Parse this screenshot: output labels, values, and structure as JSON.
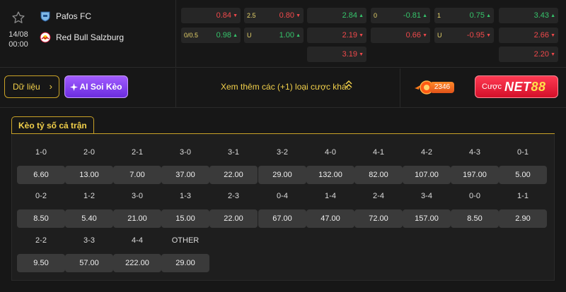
{
  "match": {
    "date": "14/08",
    "time": "00:00",
    "home_team": "Pafos FC",
    "away_team": "Red Bull Salzburg"
  },
  "odds": {
    "row1": [
      {
        "line": "",
        "value": "0.84",
        "dir": "down"
      },
      {
        "line": "2.5",
        "value": "0.80",
        "dir": "down"
      },
      {
        "line": "",
        "value": "2.84",
        "dir": "up"
      },
      {
        "line": "0",
        "value": "-0.81",
        "dir": "up"
      },
      {
        "line": "1",
        "value": "0.75",
        "dir": "up"
      },
      {
        "line": "",
        "value": "3.43",
        "dir": "up"
      }
    ],
    "row2": [
      {
        "line": "0/0.5",
        "value": "0.98",
        "dir": "up"
      },
      {
        "line": "U",
        "value": "1.00",
        "dir": "up"
      },
      {
        "line": "",
        "value": "2.19",
        "dir": "down"
      },
      {
        "line": "",
        "value": "0.66",
        "dir": "down"
      },
      {
        "line": "U",
        "value": "-0.95",
        "dir": "down"
      },
      {
        "line": "",
        "value": "2.66",
        "dir": "down"
      }
    ],
    "row3": [
      {
        "line": "",
        "value": "3.19",
        "dir": "down"
      },
      {
        "line": "",
        "value": "2.20",
        "dir": "down"
      }
    ]
  },
  "actions": {
    "data_label": "Dữ liệu",
    "ai_label": "AI Soi Kèo",
    "more_label": "Xem thêm các (+1) loại cược khác",
    "promo_count": "2346",
    "cuoc_label": "Cược",
    "net_label": "NET",
    "net_num": "88"
  },
  "score_tab": "Kèo tỷ số cả trận",
  "scores": [
    {
      "score": "1-0",
      "odd": "6.60"
    },
    {
      "score": "2-0",
      "odd": "13.00"
    },
    {
      "score": "2-1",
      "odd": "7.00"
    },
    {
      "score": "3-0",
      "odd": "37.00"
    },
    {
      "score": "3-1",
      "odd": "22.00"
    },
    {
      "score": "3-2",
      "odd": "29.00"
    },
    {
      "score": "4-0",
      "odd": "132.00"
    },
    {
      "score": "4-1",
      "odd": "82.00"
    },
    {
      "score": "4-2",
      "odd": "107.00"
    },
    {
      "score": "4-3",
      "odd": "197.00"
    },
    {
      "score": "0-1",
      "odd": "5.00"
    },
    {
      "score": "0-2",
      "odd": "8.50"
    },
    {
      "score": "1-2",
      "odd": "5.40"
    },
    {
      "score": "3-0",
      "odd": "21.00"
    },
    {
      "score": "1-3",
      "odd": "15.00"
    },
    {
      "score": "2-3",
      "odd": "22.00"
    },
    {
      "score": "0-4",
      "odd": "67.00"
    },
    {
      "score": "1-4",
      "odd": "47.00"
    },
    {
      "score": "2-4",
      "odd": "72.00"
    },
    {
      "score": "3-4",
      "odd": "157.00"
    },
    {
      "score": "0-0",
      "odd": "8.50"
    },
    {
      "score": "1-1",
      "odd": "2.90"
    },
    {
      "score": "2-2",
      "odd": "9.50"
    },
    {
      "score": "3-3",
      "odd": "57.00"
    },
    {
      "score": "4-4",
      "odd": "222.00"
    },
    {
      "score": "OTHER",
      "odd": "29.00"
    }
  ],
  "colors": {
    "accent": "#f2d04a",
    "up": "#36c46b",
    "down": "#f0494b"
  }
}
